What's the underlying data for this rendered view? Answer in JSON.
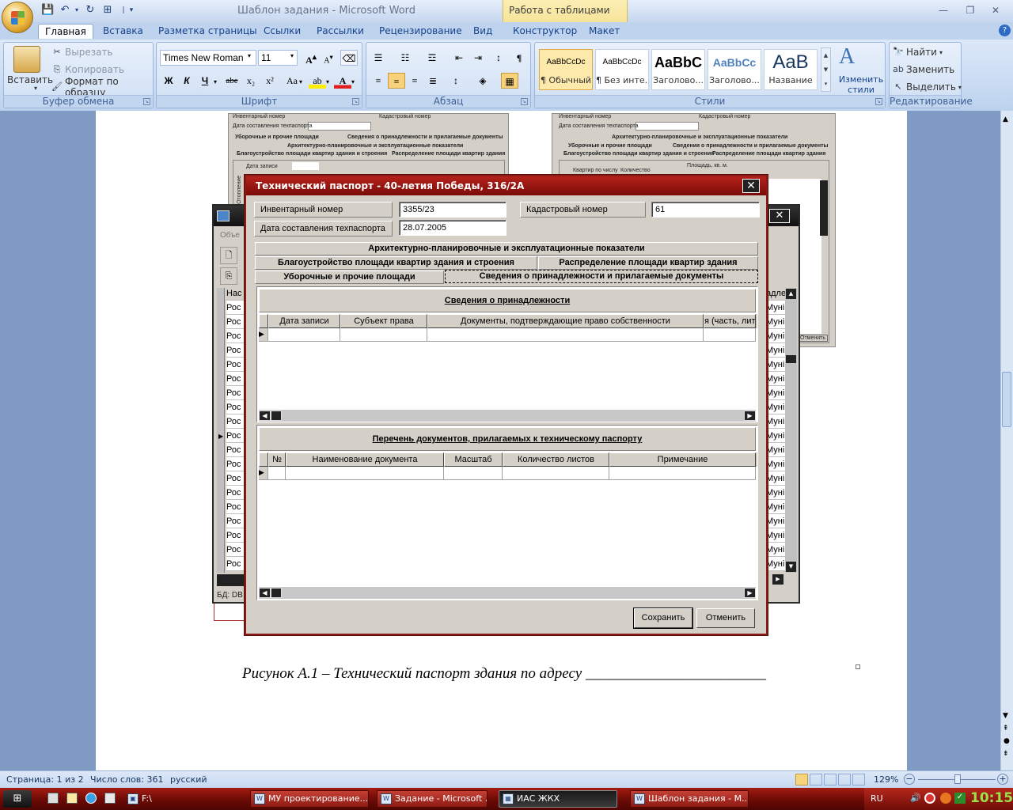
{
  "window": {
    "title": "Шаблон задания - Microsoft Word",
    "context_tab": "Работа с таблицами"
  },
  "ribbon_tabs": [
    "Главная",
    "Вставка",
    "Разметка страницы",
    "Ссылки",
    "Рассылки",
    "Рецензирование",
    "Вид",
    "Конструктор",
    "Макет"
  ],
  "clipboard": {
    "paste": "Вставить",
    "cut": "Вырезать",
    "copy": "Копировать",
    "format_painter": "Формат по образцу",
    "label": "Буфер обмена"
  },
  "font": {
    "name": "Times New Roman",
    "size": "11",
    "label": "Шрифт",
    "bold": "Ж",
    "italic": "К",
    "underline": "Ч",
    "strike": "abe",
    "sub": "x₂",
    "sup": "x²",
    "case": "Aa"
  },
  "paragraph": {
    "label": "Абзац"
  },
  "styles": {
    "label": "Стили",
    "items": [
      {
        "sample": "AaBbCcDc",
        "name": "¶ Обычный"
      },
      {
        "sample": "AaBbCcDc",
        "name": "¶ Без инте..."
      },
      {
        "sample": "AaBbC",
        "name": "Заголово..."
      },
      {
        "sample": "AaBbCc",
        "name": "Заголово..."
      },
      {
        "sample": "AaB",
        "name": "Название"
      }
    ],
    "change": "Изменить стили"
  },
  "editing": {
    "find": "Найти",
    "replace": "Заменить",
    "select": "Выделить",
    "label": "Редактирование"
  },
  "dialog": {
    "title": "Технический паспорт - 40-летия Победы, 316/2А",
    "inv_label": "Инвентарный номер",
    "inv_value": "3355/23",
    "cad_label": "Кадастровый номер",
    "cad_value": "61",
    "date_label": "Дата составления техпаспорта",
    "date_value": "28.07.2005",
    "tabs": {
      "arch": "Архитектурно-планировочные и эксплуатационные показатели",
      "landscaping": "Благоустройство площади квартир здания и строения",
      "distribution": "Распределение площади квартир здания",
      "cleaning": "Уборочные и прочие площади",
      "ownership": "Сведения о принадлежности и прилагаемые документы"
    },
    "ownership_title": "Сведения о принадлежности",
    "ownership_cols": [
      "Дата записи",
      "Субъект права",
      "Документы, подтверждающие право собственности",
      "я (часть, лит"
    ],
    "docs_title": "Перечень документов, прилагаемых к техническому паспорту",
    "docs_cols": [
      "№",
      "Наименование документа",
      "Масштаб",
      "Количество листов",
      "Примечание"
    ],
    "save": "Сохранить",
    "cancel": "Отменить"
  },
  "background_window": {
    "row_prefix": "Рос",
    "col_header": "Нас",
    "right_prefix": "Муні",
    "right_header": "адлех",
    "status_prefix": "БД: DB",
    "menu_hint": "Объе"
  },
  "bg_shots": {
    "inv": "Инвентарный номер",
    "cad": "Кадастровый номер",
    "date": "Дата составления техпаспорта",
    "cleaning": "Уборочные и прочие площади",
    "ownership": "Сведения о принадлежности и прилагаемые документы",
    "arch": "Архитектурно-планировочные и эксплуатационные показатели",
    "landscaping": "Благоустройство площади квартир здания и строения",
    "distribution": "Распределение площади квартир здания",
    "date_rec": "Дата записи",
    "heating": "Отопление",
    "flats": "Квартир по числу",
    "count": "Количество",
    "area": "Площадь, кв. м.",
    "cancel": "Отменить"
  },
  "caption": "Рисунок А.1 – Технический паспорт здания по адресу ________________________",
  "statusbar": {
    "page": "Страница: 1 из 2",
    "words": "Число слов: 361",
    "lang": "русский",
    "zoom": "129%"
  },
  "taskbar": {
    "items": [
      "F:\\",
      "МУ проектирование...",
      "Задание - Microsoft ...",
      "ИАС ЖКХ",
      "Шаблон задания - M..."
    ],
    "lang": "RU",
    "clock": "10:15"
  },
  "colors": {
    "ribbon": "#c7daf2",
    "dialog_title": "#b5211b",
    "taskbar": "#7a0c08"
  }
}
